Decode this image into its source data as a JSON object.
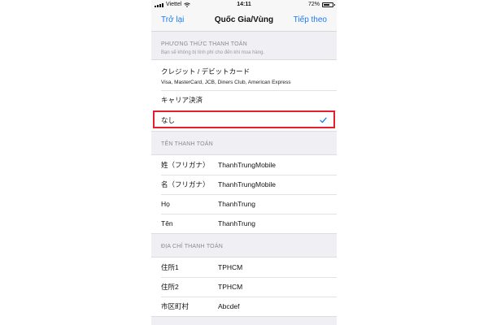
{
  "status_bar": {
    "carrier": "Viettel",
    "time": "14:11",
    "battery": "72%",
    "battery_level": 0.72
  },
  "nav": {
    "back": "Trở lại",
    "title": "Quốc Gia/Vùng",
    "next": "Tiếp theo"
  },
  "payment_method": {
    "header": "PHƯƠNG THỨC THANH TOÁN",
    "subheader": "Bạn sẽ không bị tính phí cho đến khi mua hàng.",
    "options": [
      {
        "label": "クレジット / デビットカード",
        "sub": "Visa, MasterCard, JCB, Diners Club, American Express"
      },
      {
        "label": "キャリア決済"
      },
      {
        "label": "なし",
        "selected": true
      }
    ]
  },
  "billing_name": {
    "header": "TÊN THANH TOÁN",
    "fields": [
      {
        "label": "姓（フリガナ）",
        "value": "ThanhTrungMobile"
      },
      {
        "label": "名（フリガナ）",
        "value": "ThanhTrungMobile"
      },
      {
        "label": "Họ",
        "value": "ThanhTrung"
      },
      {
        "label": "Tên",
        "value": "ThanhTrung"
      }
    ]
  },
  "billing_address": {
    "header": "ĐỊA CHỈ THANH TOÁN",
    "fields": [
      {
        "label": "住所1",
        "value": "TPHCM"
      },
      {
        "label": "住所2",
        "value": "TPHCM"
      },
      {
        "label": "市区町村",
        "value": "Abcdef"
      }
    ]
  },
  "colors": {
    "accent": "#1a7cf5",
    "highlight": "#e0202a"
  }
}
